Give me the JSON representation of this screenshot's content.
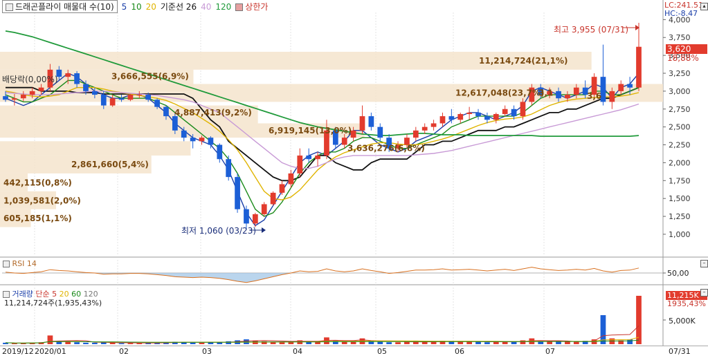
{
  "header": {
    "title": "드래곤플라이 매물대 수(10)",
    "ma_periods": [
      "5",
      "10",
      "20"
    ],
    "ma_colors": [
      "#1a3ea8",
      "#1a8a1a",
      "#e0b400"
    ],
    "kijun": "기준선 26",
    "long_ma": [
      "40",
      "120"
    ],
    "long_ma_colors": [
      "#c89ad6",
      "#1f9a3a"
    ],
    "upper_limit": "상한가",
    "lc": "LC:241.51",
    "hc": "HC:-8.47"
  },
  "annotations": {
    "high": "최고 3,955 (07/31)",
    "low": "최저 1,060 (03/23)",
    "dividend": "배당락(0,00%)"
  },
  "price_tags": {
    "current": "3,620",
    "change_pct": "18,88%"
  },
  "rsi": {
    "label": "RSI 14",
    "value_label": "50,00"
  },
  "volume": {
    "title": "거래량",
    "ma_label": "단순",
    "ma_periods": [
      "5",
      "20",
      "60",
      "120"
    ],
    "ma_colors": [
      "#c8342b",
      "#e0b400",
      "#1a8a1a",
      "#777777"
    ],
    "summary": "11,214,724주(1,935,43%)",
    "tag_value": "11,215K",
    "tag_pct": "1935,43%",
    "axis_label": "5,000K"
  },
  "x_labels": [
    "2019/12",
    "2020/01",
    "02",
    "03",
    "04",
    "05",
    "06",
    "07",
    "07/31"
  ],
  "chart_data": {
    "type": "candlestick",
    "ylim": [
      700,
      4100
    ],
    "y_ticks": [
      1000,
      1250,
      1500,
      1750,
      2000,
      2250,
      2500,
      2750,
      3000,
      3250,
      3500,
      3750,
      4000
    ],
    "y_tick_labels": [
      "1,000",
      "1,250",
      "1,500",
      "1,750",
      "2,000",
      "2,250",
      "2,500",
      "2,750",
      "3,000",
      "3,250",
      "3,500",
      "3,750",
      "4,000"
    ],
    "price_high": 3955,
    "price_low": 1060,
    "last_close": 3620,
    "volume_profile": [
      {
        "low": 3300,
        "high": 3550,
        "volume": "11,214,724",
        "pct": "21,1%"
      },
      {
        "low": 2850,
        "high": 3100,
        "volume": "12,617,048",
        "pct": "23,7%"
      },
      {
        "low": 3000,
        "high": 3300,
        "volume": "3,666,555",
        "pct": "6,9%"
      },
      {
        "low": 2550,
        "high": 2800,
        "volume": "4,887,413",
        "pct": "9,2%"
      },
      {
        "low": 2350,
        "high": 2550,
        "volume": "6,919,145",
        "pct": "13,0%"
      },
      {
        "low": 2100,
        "high": 2300,
        "volume": "3,636,276",
        "pct": "6,8%"
      },
      {
        "low": 1850,
        "high": 2100,
        "volume": "2,861,660",
        "pct": "5,4%"
      },
      {
        "low": 1600,
        "high": 1850,
        "volume": "442,115",
        "pct": "0,8%"
      },
      {
        "low": 1350,
        "high": 1600,
        "volume": "1,039,581",
        "pct": "2,0%"
      },
      {
        "low": 1100,
        "high": 1350,
        "volume": "605,185",
        "pct": "1,1%"
      }
    ],
    "profile_text_07": "3,1",
    "profile_text_08": "3,6",
    "line_series": [
      {
        "name": "기준선 26",
        "color": "#111111",
        "values": [
          3050,
          3050,
          3050,
          3050,
          3000,
          3000,
          3000,
          3000,
          2980,
          2980,
          2980,
          2960,
          2960,
          2960,
          2960,
          2960,
          2960,
          2960,
          2960,
          2960,
          2960,
          2900,
          2750,
          2600,
          2500,
          2300,
          2200,
          2100,
          2000,
          1900,
          1800,
          1750,
          1750,
          1800,
          1950,
          2100,
          2100,
          2000,
          1950,
          1900,
          1900,
          2000,
          2050,
          2050,
          2050,
          2050,
          2150,
          2250,
          2250,
          2300,
          2300,
          2350,
          2400,
          2450,
          2450,
          2450,
          2500,
          2500,
          2550,
          2600,
          2650,
          2700,
          2700,
          2750,
          2750,
          2800,
          2850,
          2900,
          2900,
          2950,
          3000,
          3050
        ]
      },
      {
        "name": "5",
        "color": "#1a3ea8",
        "values": [
          2900,
          2850,
          2800,
          2850,
          2950,
          3050,
          3150,
          3250,
          3200,
          3100,
          3000,
          2950,
          2900,
          2900,
          2950,
          2950,
          2900,
          2800,
          2700,
          2550,
          2450,
          2350,
          2300,
          2250,
          2100,
          1900,
          1600,
          1300,
          1120,
          1200,
          1400,
          1600,
          1800,
          2000,
          2100,
          2150,
          2100,
          2200,
          2300,
          2450,
          2450,
          2350,
          2250,
          2200,
          2150,
          2200,
          2300,
          2350,
          2400,
          2500,
          2600,
          2650,
          2700,
          2700,
          2650,
          2600,
          2650,
          2700,
          2800,
          3000,
          3050,
          3000,
          2950,
          2900,
          2950,
          3000,
          3100,
          3050,
          2900,
          3050,
          3100,
          3250
        ]
      },
      {
        "name": "10",
        "color": "#1a8a1a",
        "values": [
          2950,
          2900,
          2850,
          2850,
          2900,
          2950,
          3050,
          3150,
          3150,
          3100,
          3050,
          3000,
          2950,
          2900,
          2900,
          2900,
          2900,
          2850,
          2800,
          2700,
          2600,
          2500,
          2400,
          2300,
          2200,
          2050,
          1850,
          1600,
          1350,
          1250,
          1300,
          1450,
          1650,
          1850,
          2000,
          2100,
          2150,
          2150,
          2200,
          2300,
          2350,
          2350,
          2300,
          2250,
          2200,
          2200,
          2250,
          2300,
          2350,
          2400,
          2500,
          2550,
          2600,
          2650,
          2650,
          2650,
          2650,
          2650,
          2700,
          2800,
          2900,
          2950,
          2950,
          2950,
          2950,
          2950,
          3000,
          3000,
          2950,
          2950,
          3000,
          3050
        ]
      },
      {
        "name": "20",
        "color": "#e0b400",
        "values": [
          3000,
          2980,
          2950,
          2930,
          2920,
          2930,
          2950,
          3000,
          3050,
          3050,
          3050,
          3030,
          3000,
          2980,
          2960,
          2940,
          2920,
          2900,
          2870,
          2820,
          2760,
          2700,
          2620,
          2540,
          2440,
          2320,
          2180,
          2000,
          1800,
          1600,
          1500,
          1480,
          1520,
          1620,
          1760,
          1900,
          2000,
          2080,
          2140,
          2180,
          2220,
          2260,
          2280,
          2280,
          2260,
          2250,
          2250,
          2270,
          2300,
          2330,
          2370,
          2420,
          2470,
          2520,
          2560,
          2590,
          2610,
          2620,
          2640,
          2680,
          2740,
          2800,
          2840,
          2870,
          2890,
          2900,
          2910,
          2920,
          2920,
          2930,
          2950,
          2980
        ]
      },
      {
        "name": "40",
        "color": "#c89ad6",
        "values": [
          2980,
          2970,
          2960,
          2950,
          2950,
          2950,
          2960,
          2970,
          2980,
          2990,
          3000,
          3000,
          2990,
          2980,
          2970,
          2960,
          2950,
          2940,
          2920,
          2900,
          2880,
          2850,
          2800,
          2750,
          2700,
          2600,
          2500,
          2400,
          2300,
          2200,
          2100,
          2000,
          1950,
          1920,
          1920,
          1950,
          2000,
          2050,
          2080,
          2100,
          2100,
          2100,
          2100,
          2100,
          2100,
          2100,
          2110,
          2120,
          2130,
          2150,
          2170,
          2200,
          2230,
          2260,
          2290,
          2320,
          2350,
          2380,
          2410,
          2440,
          2470,
          2500,
          2530,
          2560,
          2590,
          2620,
          2650,
          2680,
          2710,
          2740,
          2780,
          2820
        ]
      },
      {
        "name": "120",
        "color": "#1f9a3a",
        "values": [
          3840,
          3820,
          3790,
          3760,
          3720,
          3680,
          3640,
          3600,
          3560,
          3520,
          3480,
          3440,
          3400,
          3360,
          3320,
          3280,
          3240,
          3200,
          3160,
          3120,
          3080,
          3040,
          3000,
          2960,
          2920,
          2880,
          2840,
          2800,
          2760,
          2720,
          2680,
          2640,
          2600,
          2560,
          2530,
          2500,
          2480,
          2460,
          2440,
          2420,
          2400,
          2390,
          2380,
          2380,
          2390,
          2400,
          2410,
          2410,
          2400,
          2390,
          2390,
          2390,
          2380,
          2380,
          2380,
          2380,
          2380,
          2380,
          2380,
          2380,
          2370,
          2370,
          2370,
          2370,
          2370,
          2370,
          2370,
          2370,
          2370,
          2370,
          2370,
          2380
        ]
      }
    ],
    "candles": [
      [
        2930,
        3000,
        2850,
        2880
      ],
      [
        2880,
        2960,
        2800,
        2900
      ],
      [
        2900,
        3000,
        2860,
        2950
      ],
      [
        2950,
        3050,
        2900,
        3000
      ],
      [
        3000,
        3100,
        2950,
        3050
      ],
      [
        3050,
        3380,
        3000,
        3300
      ],
      [
        3300,
        3350,
        3150,
        3200
      ],
      [
        3200,
        3300,
        3100,
        3250
      ],
      [
        3250,
        3280,
        3050,
        3100
      ],
      [
        3100,
        3150,
        2950,
        3000
      ],
      [
        3000,
        3050,
        2900,
        2950
      ],
      [
        2950,
        3000,
        2750,
        2800
      ],
      [
        2800,
        2950,
        2780,
        2900
      ],
      [
        2900,
        2950,
        2850,
        2880
      ],
      [
        2880,
        2960,
        2860,
        2950
      ],
      [
        2950,
        3000,
        2900,
        2950
      ],
      [
        2950,
        2980,
        2850,
        2880
      ],
      [
        2880,
        2900,
        2750,
        2780
      ],
      [
        2780,
        2800,
        2600,
        2650
      ],
      [
        2650,
        2700,
        2400,
        2450
      ],
      [
        2450,
        2500,
        2300,
        2350
      ],
      [
        2350,
        2400,
        2200,
        2300
      ],
      [
        2300,
        2380,
        2250,
        2350
      ],
      [
        2350,
        2370,
        2200,
        2250
      ],
      [
        2250,
        2270,
        2000,
        2050
      ],
      [
        2050,
        2100,
        1750,
        1800
      ],
      [
        1800,
        1850,
        1300,
        1350
      ],
      [
        1350,
        1400,
        1060,
        1150
      ],
      [
        1150,
        1300,
        1100,
        1280
      ],
      [
        1280,
        1450,
        1250,
        1420
      ],
      [
        1420,
        1600,
        1400,
        1580
      ],
      [
        1580,
        1750,
        1550,
        1700
      ],
      [
        1700,
        1900,
        1650,
        1850
      ],
      [
        1850,
        2200,
        1800,
        2100
      ],
      [
        2100,
        2200,
        2000,
        2050
      ],
      [
        2050,
        2150,
        1950,
        2100
      ],
      [
        2100,
        2600,
        2050,
        2450
      ],
      [
        2450,
        2500,
        2200,
        2250
      ],
      [
        2250,
        2400,
        2200,
        2350
      ],
      [
        2350,
        2500,
        2300,
        2450
      ],
      [
        2450,
        2800,
        2400,
        2650
      ],
      [
        2650,
        2700,
        2450,
        2500
      ],
      [
        2500,
        2550,
        2300,
        2350
      ],
      [
        2350,
        2400,
        2150,
        2200
      ],
      [
        2200,
        2300,
        2150,
        2250
      ],
      [
        2250,
        2400,
        2200,
        2350
      ],
      [
        2350,
        2500,
        2300,
        2450
      ],
      [
        2450,
        2550,
        2400,
        2500
      ],
      [
        2500,
        2600,
        2450,
        2550
      ],
      [
        2550,
        2700,
        2500,
        2650
      ],
      [
        2650,
        2750,
        2550,
        2600
      ],
      [
        2600,
        2700,
        2550,
        2680
      ],
      [
        2680,
        2780,
        2600,
        2700
      ],
      [
        2700,
        2750,
        2600,
        2650
      ],
      [
        2650,
        2700,
        2550,
        2600
      ],
      [
        2600,
        2700,
        2550,
        2680
      ],
      [
        2680,
        2800,
        2650,
        2750
      ],
      [
        2750,
        2800,
        2600,
        2650
      ],
      [
        2650,
        2900,
        2600,
        2850
      ],
      [
        2850,
        3100,
        2800,
        3050
      ],
      [
        3050,
        3100,
        2900,
        2950
      ],
      [
        2950,
        3050,
        2900,
        3000
      ],
      [
        3000,
        3050,
        2850,
        2900
      ],
      [
        2900,
        3000,
        2850,
        2950
      ],
      [
        2950,
        3100,
        2900,
        3050
      ],
      [
        3050,
        3150,
        2900,
        2950
      ],
      [
        2950,
        3250,
        2900,
        3200
      ],
      [
        3200,
        3650,
        2800,
        2850
      ],
      [
        2850,
        3050,
        2750,
        3000
      ],
      [
        3000,
        3150,
        2950,
        3100
      ],
      [
        3100,
        3200,
        2950,
        3050
      ],
      [
        3050,
        3955,
        3000,
        3620
      ]
    ],
    "volumes": [
      3,
      2,
      2,
      3,
      4,
      18,
      6,
      5,
      4,
      3,
      3,
      4,
      3,
      2,
      2,
      2,
      3,
      3,
      4,
      5,
      4,
      3,
      3,
      4,
      5,
      6,
      8,
      10,
      7,
      6,
      5,
      5,
      6,
      8,
      6,
      5,
      14,
      7,
      5,
      6,
      12,
      7,
      5,
      4,
      4,
      5,
      6,
      5,
      5,
      7,
      5,
      5,
      6,
      5,
      4,
      5,
      6,
      5,
      8,
      12,
      6,
      5,
      5,
      5,
      6,
      7,
      10,
      60,
      12,
      8,
      10,
      100
    ],
    "rsi_values": [
      52,
      50,
      49,
      51,
      53,
      58,
      56,
      55,
      53,
      51,
      50,
      47,
      48,
      48,
      49,
      49,
      48,
      46,
      44,
      41,
      40,
      39,
      40,
      39,
      37,
      34,
      30,
      27,
      31,
      36,
      41,
      46,
      50,
      55,
      53,
      54,
      60,
      55,
      53,
      55,
      60,
      56,
      53,
      49,
      51,
      54,
      57,
      57,
      58,
      60,
      57,
      58,
      59,
      57,
      55,
      57,
      59,
      56,
      60,
      64,
      60,
      58,
      56,
      57,
      59,
      57,
      61,
      55,
      52,
      56,
      57,
      62
    ]
  }
}
